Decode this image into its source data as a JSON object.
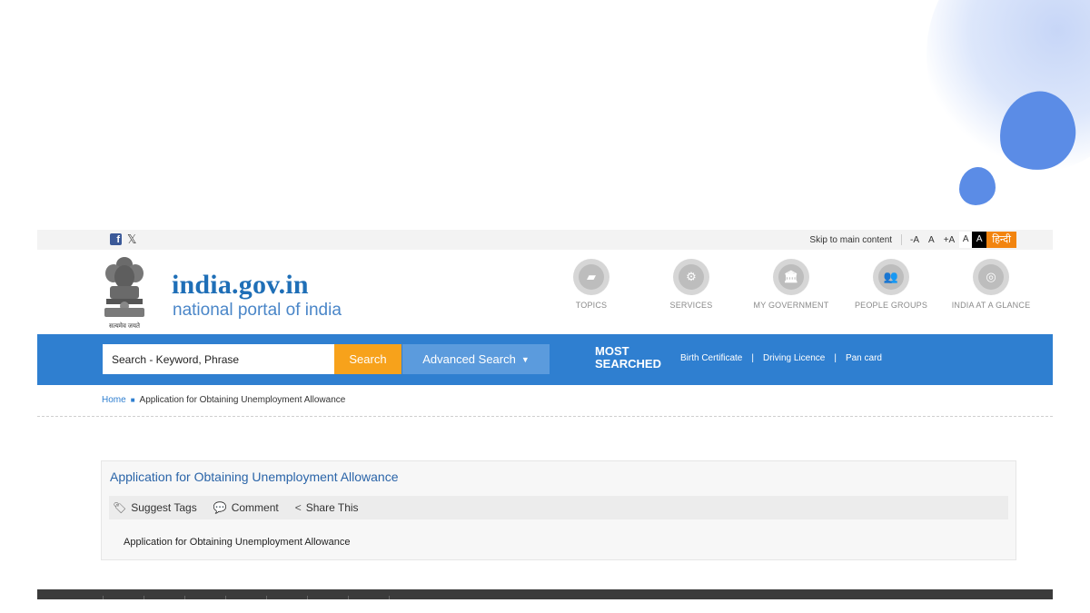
{
  "topbar": {
    "social": [
      {
        "name": "facebook-icon",
        "glyph": "f"
      },
      {
        "name": "x-icon",
        "glyph": "𝕏"
      }
    ],
    "skip_link": "Skip to main content",
    "font_sizes": [
      "-A",
      "A",
      "+A"
    ],
    "contrast_light": "A",
    "contrast_dark": "A",
    "language": "हिन्दी"
  },
  "header": {
    "emblem_caption": "सत्यमेव जयते",
    "title": "india.gov.in",
    "subtitle": "national portal of india",
    "nav": [
      {
        "label": "TOPICS",
        "icon": "topics-icon",
        "glyph": "▰"
      },
      {
        "label": "SERVICES",
        "icon": "services-icon",
        "glyph": "⚙"
      },
      {
        "label": "MY GOVERNMENT",
        "icon": "government-icon",
        "glyph": "🏛"
      },
      {
        "label": "PEOPLE GROUPS",
        "icon": "people-groups-icon",
        "glyph": "👥"
      },
      {
        "label": "INDIA AT A GLANCE",
        "icon": "india-glance-icon",
        "glyph": "◎"
      }
    ]
  },
  "search": {
    "placeholder": "Search - Keyword, Phrase",
    "button": "Search",
    "advanced": "Advanced Search",
    "most_searched": [
      "MOST",
      "SEARCHED"
    ],
    "links": [
      "Birth Certificate",
      "Driving Licence",
      "Pan card"
    ]
  },
  "breadcrumb": {
    "home": "Home",
    "current": "Application for Obtaining Unemployment Allowance"
  },
  "content": {
    "title": "Application for Obtaining Unemployment Allowance",
    "actions": [
      {
        "label": "Suggest Tags",
        "icon": "tag-icon",
        "glyph": "🏷"
      },
      {
        "label": "Comment",
        "icon": "comment-icon",
        "glyph": "💬"
      },
      {
        "label": "Share This",
        "icon": "share-icon",
        "glyph": "<"
      }
    ],
    "body": "Application for Obtaining Unemployment Allowance"
  },
  "colors": {
    "brand_blue": "#2f7fd0",
    "search_orange": "#f7a21b",
    "hindi_orange": "#f2840f",
    "deco_blue": "#5b8ce6"
  }
}
